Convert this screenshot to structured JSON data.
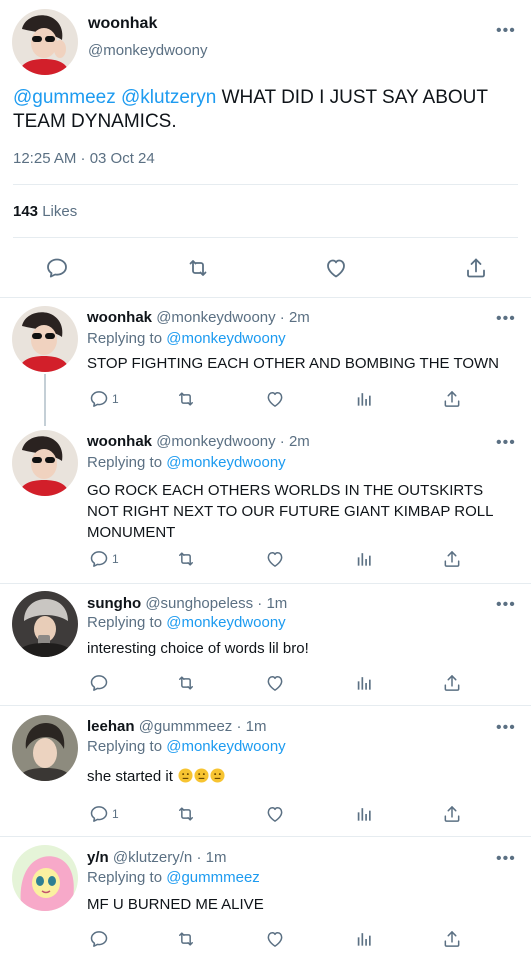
{
  "main_tweet": {
    "display_name": "woonhak",
    "handle": "@monkeydwoony",
    "mention1": "@gummeez",
    "mention2": "@klutzeryn",
    "body": " WHAT DID I JUST SAY ABOUT TEAM DYNAMICS.",
    "timestamp": "12:25 AM · 03 Oct 24",
    "likes_count": "143",
    "likes_label": " Likes"
  },
  "replies": [
    {
      "display_name": "woonhak",
      "meta": "@monkeydwoony · 2m",
      "replying_label": "Replying to ",
      "replying_to": "@monkeydwoony",
      "text": "STOP FIGHTING EACH OTHER AND BOMBING THE TOWN",
      "reply_count": "1"
    },
    {
      "display_name": "woonhak",
      "meta": "@monkeydwoony · 2m",
      "replying_label": "Replying to ",
      "replying_to": "@monkeydwoony",
      "text": "GO ROCK EACH OTHERS WORLDS IN THE OUTSKIRTS NOT RIGHT NEXT TO OUR FUTURE GIANT KIMBAP ROLL MONUMENT",
      "reply_count": "1"
    },
    {
      "display_name": "sungho",
      "meta": "@sunghopeless · 1m",
      "replying_label": "Replying to ",
      "replying_to": "@monkeydwoony",
      "text": "interesting choice of words lil bro!",
      "reply_count": ""
    },
    {
      "display_name": "leehan",
      "meta": "@gummmeez · 1m",
      "replying_label": "Replying to ",
      "replying_to": "@monkeydwoony",
      "text": "she started it",
      "emojis": [
        "neutral-face-emoji",
        "neutral-face-emoji",
        "neutral-face-emoji"
      ],
      "reply_count": "1"
    },
    {
      "display_name": "y/n",
      "meta": "@klutzery/n · 1m",
      "replying_label": "Replying to ",
      "replying_to": "@gummmeez",
      "text": "MF U BURNED ME ALIVE",
      "reply_count": ""
    }
  ],
  "colors": {
    "accent": "#1d9bf0",
    "secondary_text": "#5b7083",
    "divider": "#e6ecf0"
  },
  "icons": [
    "more-icon",
    "reply-icon",
    "retweet-icon",
    "like-icon",
    "share-icon",
    "analytics-icon"
  ]
}
